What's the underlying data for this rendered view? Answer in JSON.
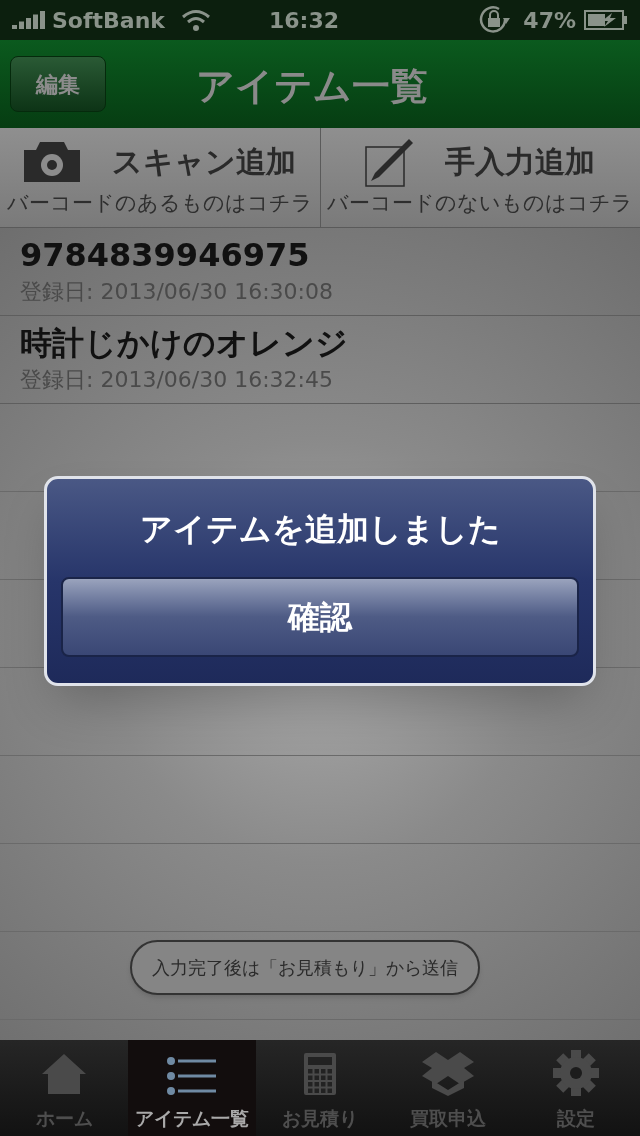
{
  "status_bar": {
    "carrier": "SoftBank",
    "time": "16:32",
    "battery": "47%"
  },
  "nav_bar": {
    "edit_button": "編集",
    "title": "アイテム一覧"
  },
  "add_buttons": [
    {
      "kind": "scan",
      "title": "スキャン追加",
      "subtitle": "バーコードのあるものはコチラ"
    },
    {
      "kind": "manual",
      "title": "手入力追加",
      "subtitle": "バーコードのないものはコチラ"
    }
  ],
  "items": [
    {
      "name": "9784839946975",
      "date": "登録日: 2013/06/30 16:30:08"
    },
    {
      "name": "時計じかけのオレンジ",
      "date": "登録日: 2013/06/30 16:32:45"
    }
  ],
  "hint_bubble": "入力完了後は「お見積もり」から送信",
  "tab_bar": [
    {
      "kind": "home",
      "label": "ホーム",
      "selected": false
    },
    {
      "kind": "list",
      "label": "アイテム一覧",
      "selected": true
    },
    {
      "kind": "calculator",
      "label": "お見積り",
      "selected": false
    },
    {
      "kind": "box",
      "label": "買取申込",
      "selected": false
    },
    {
      "kind": "settings",
      "label": "設定",
      "selected": false
    }
  ],
  "alert": {
    "message": "アイテムを追加しました",
    "button": "確認"
  }
}
